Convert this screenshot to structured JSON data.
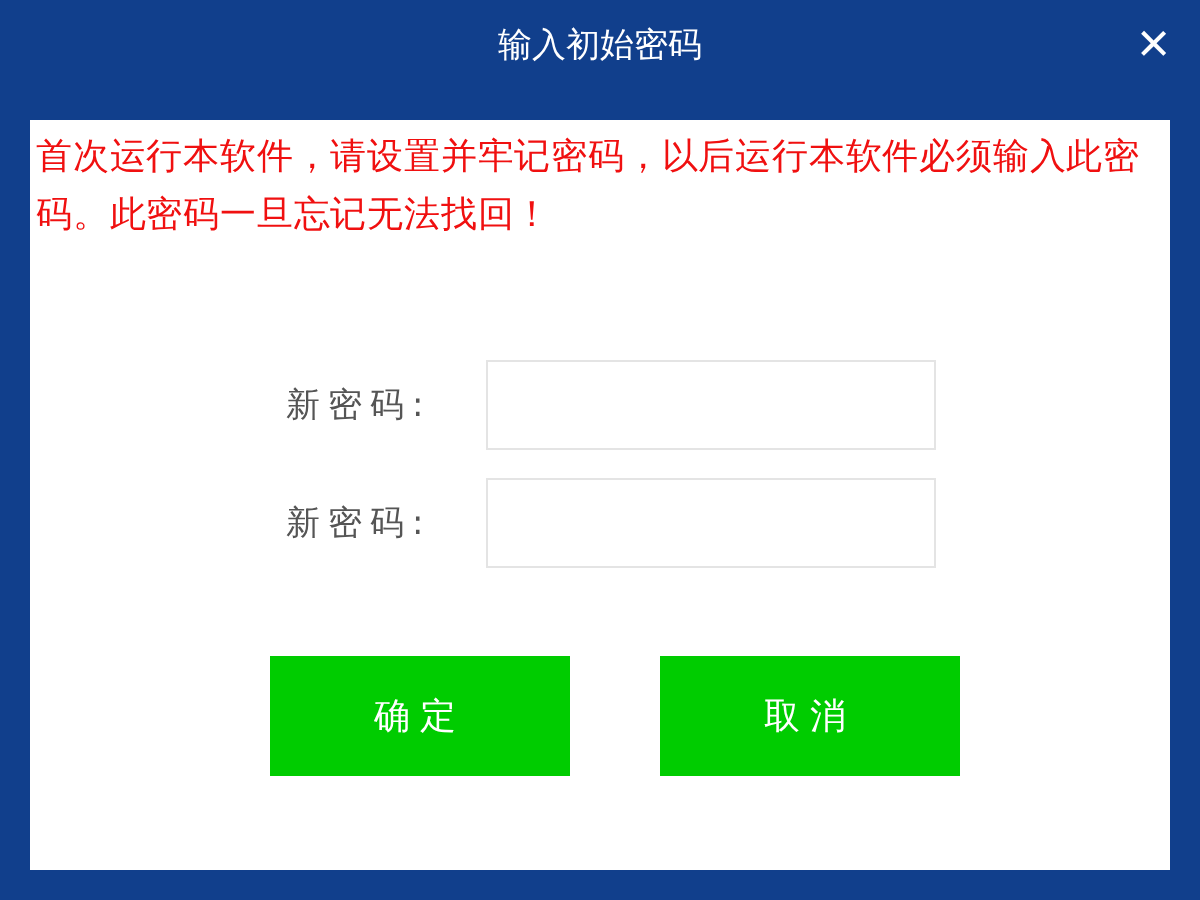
{
  "window": {
    "title": "输入初始密码",
    "close": "×"
  },
  "notice": "首次运行本软件，请设置并牢记密码，以后运行本软件必须输入此密码。此密码一旦忘记无法找回！",
  "fields": [
    {
      "label": "新密码:"
    },
    {
      "label": "新密码:"
    }
  ],
  "buttons": [
    "确定",
    "取消"
  ]
}
